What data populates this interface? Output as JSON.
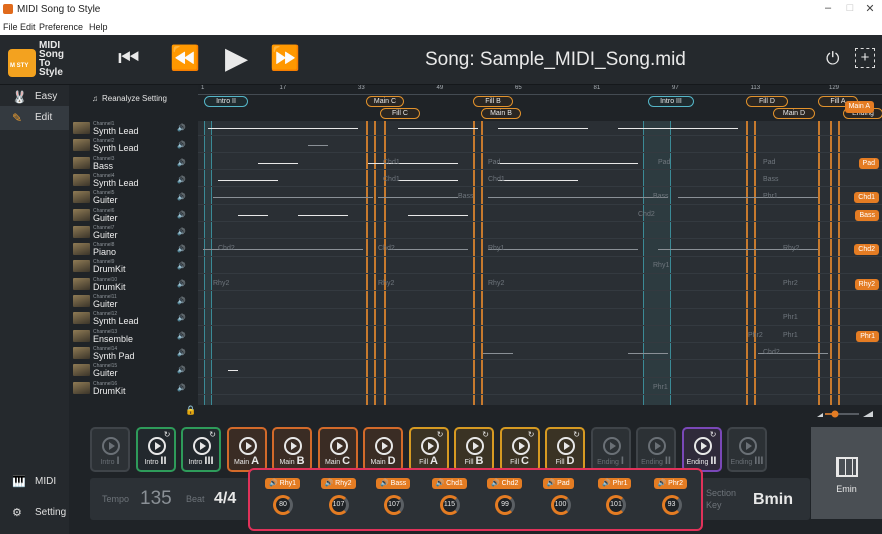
{
  "window": {
    "title": "MIDI Song to Style",
    "controls": [
      "–",
      "□",
      "✕"
    ]
  },
  "menu": [
    "File",
    "Edit",
    "Preference",
    "Help"
  ],
  "header": {
    "logo_text": "MIDI\nSong\nTo\nStyle",
    "song_title": "Song: Sample_MIDI_Song.mid",
    "transport": {
      "to_start": "⏮",
      "rewind": "⏪",
      "play": "▶",
      "fast_forward": "⏩"
    },
    "power_icon": "⏻",
    "add_icon": "+"
  },
  "sidebar": {
    "items": [
      {
        "icon": "🐰",
        "label": "Easy"
      },
      {
        "icon": "✎",
        "label": "Edit"
      }
    ],
    "bottom": [
      {
        "icon": "🎹",
        "label": "MIDI"
      },
      {
        "icon": "⚙",
        "label": "Setting"
      }
    ]
  },
  "tracklist": {
    "reanalyze_label": "Reanalyze Setting",
    "tracks": [
      {
        "channel": "Channel1",
        "name": "Synth Lead"
      },
      {
        "channel": "Channel2",
        "name": "Synth Lead"
      },
      {
        "channel": "Channel3",
        "name": "Bass"
      },
      {
        "channel": "Channel4",
        "name": "Synth Lead"
      },
      {
        "channel": "Channel5",
        "name": "Guiter"
      },
      {
        "channel": "Channel6",
        "name": "Guiter"
      },
      {
        "channel": "Channel7",
        "name": "Guiter"
      },
      {
        "channel": "Channel8",
        "name": "Piano"
      },
      {
        "channel": "Channel9",
        "name": "DrumKit"
      },
      {
        "channel": "Channel10",
        "name": "DrumKit"
      },
      {
        "channel": "Channel11",
        "name": "Guiter"
      },
      {
        "channel": "Channel12",
        "name": "Synth Lead"
      },
      {
        "channel": "Channel13",
        "name": "Ensemble"
      },
      {
        "channel": "Channel14",
        "name": "Synth Pad"
      },
      {
        "channel": "Channel15",
        "name": "Guiter"
      },
      {
        "channel": "Channel16",
        "name": "DrumKit"
      }
    ]
  },
  "timeline": {
    "ruler": [
      "1",
      "17",
      "33",
      "49",
      "65",
      "81",
      "97",
      "113",
      "129"
    ],
    "sections_top": [
      {
        "label": "Intro II",
        "color": "blue"
      },
      {
        "label": "Main C",
        "color": "orange"
      },
      {
        "label": "Fill B",
        "color": "orange"
      },
      {
        "label": "Intro III",
        "color": "blue"
      },
      {
        "label": "Fill D",
        "color": "orange"
      },
      {
        "label": "Fill A",
        "color": "orange"
      }
    ],
    "sections_bottom": [
      {
        "label": "Fill C",
        "color": "orange"
      },
      {
        "label": "Main B",
        "color": "orange"
      },
      {
        "label": "Main D",
        "color": "orange"
      },
      {
        "label": "Ending",
        "color": "orange"
      }
    ],
    "main_a_chip": "Main A",
    "lane_chips": [
      "Pad",
      "Chd1",
      "Bass",
      "Chd2",
      "Rhy2",
      "Phr1"
    ],
    "faint_labels": [
      "Chd1",
      "Pad",
      "Pad",
      "Pad",
      "Chd1",
      "Chd1",
      "Bass",
      "Bass",
      "Bass",
      "Phr1",
      "Chd2",
      "Chd2",
      "Chd2",
      "Rhy1",
      "Rhy2",
      "Rhy1",
      "Rhy2",
      "Rhy2",
      "Rhy2",
      "Phr2",
      "Phr1",
      "Phr1",
      "Phr2",
      "Chd2",
      "Phr1"
    ]
  },
  "section_buttons": [
    {
      "label": "Intro",
      "roman": "I",
      "kind": "dis",
      "sync": false
    },
    {
      "label": "Intro",
      "roman": "II",
      "kind": "intro",
      "sync": true
    },
    {
      "label": "Intro",
      "roman": "III",
      "kind": "intro",
      "sync": true
    },
    {
      "label": "Main",
      "roman": "A",
      "kind": "main",
      "sync": false
    },
    {
      "label": "Main",
      "roman": "B",
      "kind": "main",
      "sync": false
    },
    {
      "label": "Main",
      "roman": "C",
      "kind": "main",
      "sync": false
    },
    {
      "label": "Main",
      "roman": "D",
      "kind": "main",
      "sync": false
    },
    {
      "label": "Fill",
      "roman": "A",
      "kind": "fill",
      "sync": true
    },
    {
      "label": "Fill",
      "roman": "B",
      "kind": "fill",
      "sync": true
    },
    {
      "label": "Fill",
      "roman": "C",
      "kind": "fill",
      "sync": true
    },
    {
      "label": "Fill",
      "roman": "D",
      "kind": "fill",
      "sync": true
    },
    {
      "label": "Ending",
      "roman": "I",
      "kind": "dis",
      "sync": false
    },
    {
      "label": "Ending",
      "roman": "II",
      "kind": "dis",
      "sync": false
    },
    {
      "label": "Ending",
      "roman": "II",
      "kind": "ending",
      "sync": true
    },
    {
      "label": "Ending",
      "roman": "III",
      "kind": "dis",
      "sync": false
    }
  ],
  "chord_box": {
    "label": "Emin"
  },
  "status": {
    "tempo_label": "Tempo",
    "tempo_value": "135",
    "beat_label": "Beat",
    "beat_value": "4/4",
    "section_label": "Section",
    "key_label": "Key",
    "key_value": "Bmin"
  },
  "mixer": [
    {
      "part": "Rhy1",
      "value": "80",
      "level": 0.63
    },
    {
      "part": "Rhy2",
      "value": "107",
      "level": 0.84
    },
    {
      "part": "Bass",
      "value": "107",
      "level": 0.84
    },
    {
      "part": "Chd1",
      "value": "115",
      "level": 0.91
    },
    {
      "part": "Chd2",
      "value": "99",
      "level": 0.78
    },
    {
      "part": "Pad",
      "value": "100",
      "level": 0.79
    },
    {
      "part": "Phr1",
      "value": "101",
      "level": 0.8
    },
    {
      "part": "Phr2",
      "value": "93",
      "level": 0.73
    }
  ],
  "colors": {
    "accent": "#e47c23",
    "highlight": "#e1325a",
    "intro": "#2e9b5a",
    "main": "#d36a2a",
    "fill": "#d69a22",
    "ending": "#7a48b8"
  }
}
